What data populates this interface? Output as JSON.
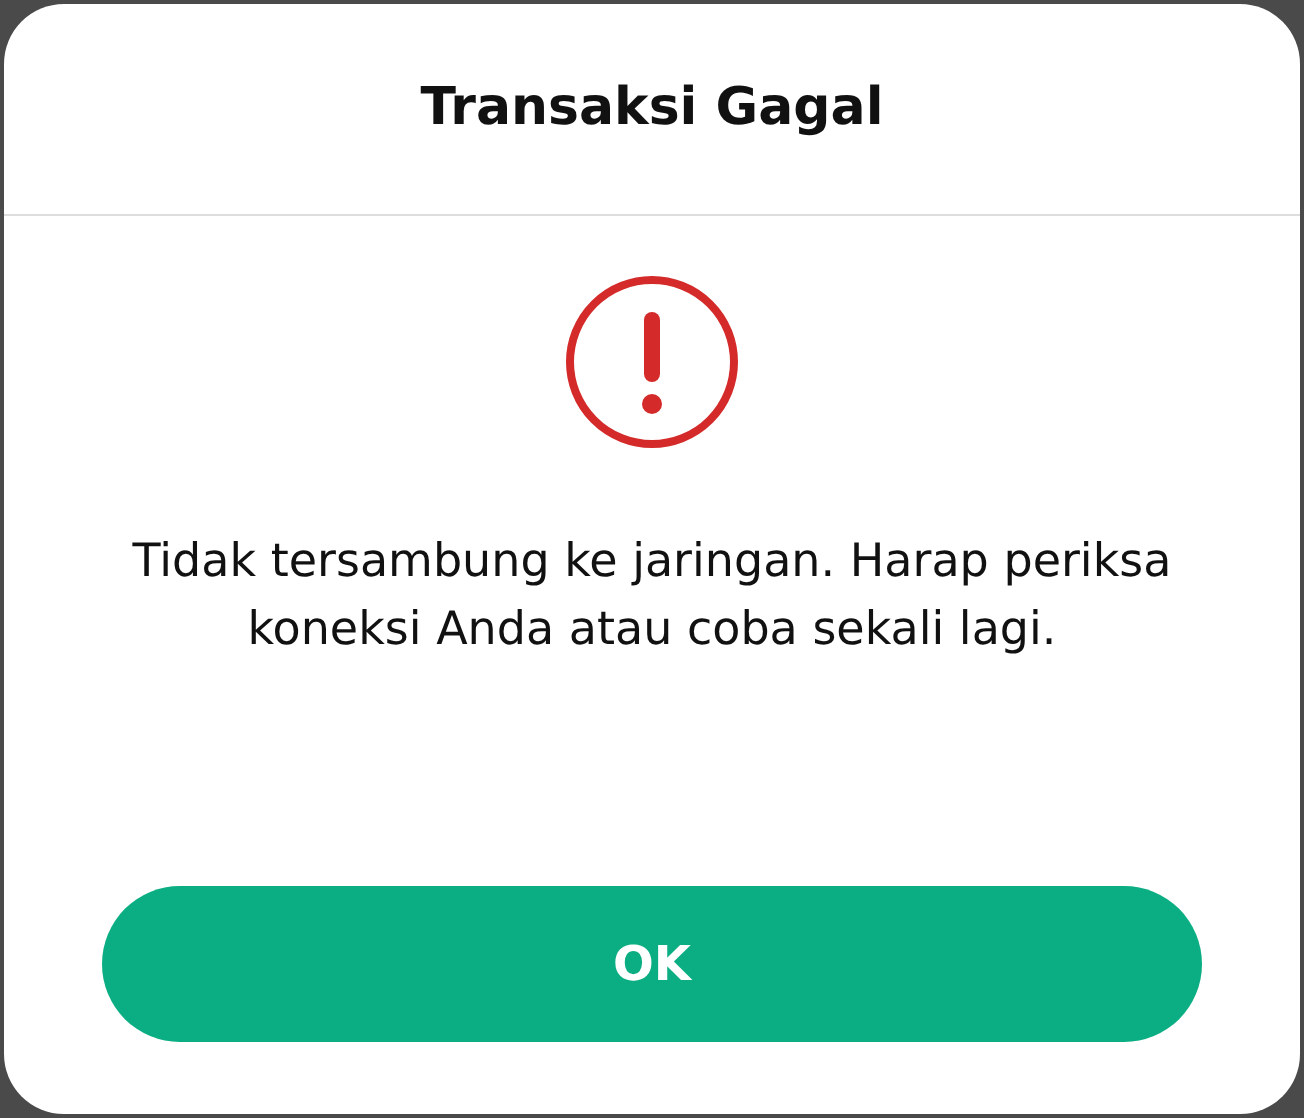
{
  "dialog": {
    "title": "Transaksi Gagal",
    "message": "Tidak tersambung ke jaringan. Harap periksa koneksi Anda atau coba sekali lagi.",
    "buttons": [
      "OK"
    ]
  }
}
